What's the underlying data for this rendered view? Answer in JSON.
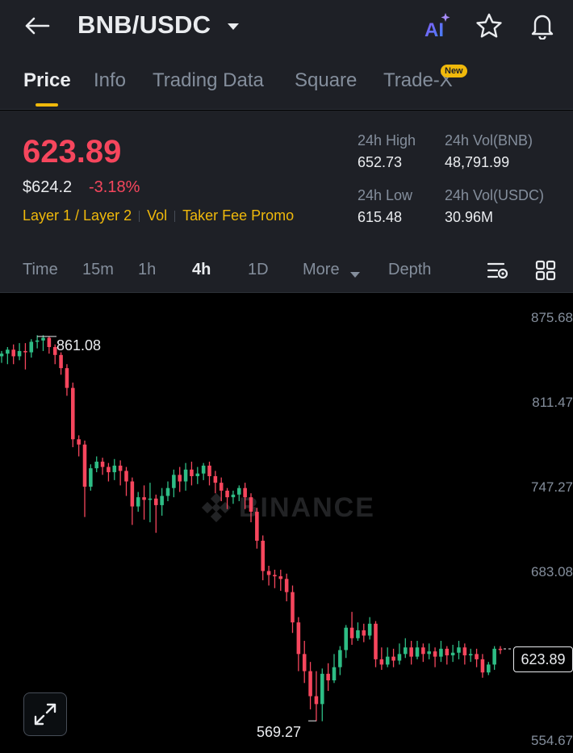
{
  "header": {
    "pair": "BNB/USDC",
    "icons": [
      "back-arrow-icon",
      "chevron-down-icon",
      "ai-icon",
      "star-icon",
      "bell-icon"
    ],
    "ai_label": "AI"
  },
  "tabs": [
    {
      "label": "Price",
      "active": true
    },
    {
      "label": "Info"
    },
    {
      "label": "Trading Data"
    },
    {
      "label": "Square"
    },
    {
      "label": "Trade-X",
      "badge": "New"
    }
  ],
  "ticker": {
    "last_price": "623.89",
    "usd_price": "$624.2",
    "change_pct": "-3.18%",
    "tags": [
      "Layer 1 / Layer 2",
      "Vol",
      "Taker Fee Promo"
    ],
    "high_label": "24h High",
    "high_value": "652.73",
    "low_label": "24h Low",
    "low_value": "615.48",
    "vol_base_label": "24h Vol(BNB)",
    "vol_base_value": "48,791.99",
    "vol_quote_label": "24h Vol(USDC)",
    "vol_quote_value": "30.96M"
  },
  "timeframes": [
    "Time",
    "15m",
    "1h",
    "4h",
    "1D",
    "More",
    "Depth"
  ],
  "active_timeframe": "4h",
  "chart": {
    "watermark": "BINANCE",
    "y_ticks": [
      "875.68",
      "811.47",
      "747.27",
      "683.08",
      "554.67"
    ],
    "high_label": "861.08",
    "low_label": "569.27",
    "last_price_label": "623.89",
    "colors": {
      "up": "#2ebd85",
      "down": "#f6465d",
      "accent": "#f0b90b"
    }
  },
  "chart_data": {
    "type": "candlestick",
    "ylim": [
      554.67,
      875.68
    ],
    "y_ticks": [
      875.68,
      811.47,
      747.27,
      683.08,
      554.67
    ],
    "marked_high": 861.08,
    "marked_low": 569.27,
    "last": 623.89,
    "candles": [
      [
        846,
        848,
        841,
        850
      ],
      [
        848,
        851,
        840,
        853
      ],
      [
        851,
        846,
        840,
        855
      ],
      [
        846,
        850,
        843,
        856
      ],
      [
        850,
        849,
        836,
        856
      ],
      [
        849,
        857,
        845,
        859
      ],
      [
        857,
        858,
        852,
        862
      ],
      [
        858,
        860,
        850,
        862
      ],
      [
        860,
        853,
        848,
        861
      ],
      [
        853,
        847,
        840,
        855
      ],
      [
        847,
        837,
        832,
        849
      ],
      [
        837,
        822,
        816,
        840
      ],
      [
        822,
        783,
        777,
        826
      ],
      [
        783,
        779,
        770,
        786
      ],
      [
        779,
        747,
        724,
        782
      ],
      [
        747,
        761,
        744,
        764
      ],
      [
        761,
        766,
        758,
        770
      ],
      [
        766,
        762,
        756,
        769
      ],
      [
        762,
        758,
        751,
        765
      ],
      [
        758,
        763,
        752,
        768
      ],
      [
        763,
        759,
        748,
        767
      ],
      [
        759,
        751,
        740,
        762
      ],
      [
        751,
        732,
        718,
        754
      ],
      [
        732,
        739,
        728,
        743
      ],
      [
        739,
        737,
        722,
        748
      ],
      [
        737,
        738,
        720,
        750
      ],
      [
        738,
        733,
        712,
        741
      ],
      [
        733,
        740,
        725,
        746
      ],
      [
        740,
        746,
        736,
        751
      ],
      [
        746,
        756,
        739,
        760
      ],
      [
        756,
        751,
        743,
        762
      ],
      [
        751,
        760,
        744,
        765
      ],
      [
        760,
        755,
        748,
        766
      ],
      [
        755,
        757,
        749,
        762
      ],
      [
        757,
        763,
        752,
        765
      ],
      [
        763,
        755,
        748,
        766
      ],
      [
        755,
        750,
        742,
        759
      ],
      [
        750,
        744,
        736,
        754
      ],
      [
        744,
        739,
        730,
        746
      ],
      [
        739,
        741,
        734,
        744
      ],
      [
        741,
        746,
        736,
        748
      ],
      [
        746,
        739,
        730,
        750
      ],
      [
        739,
        728,
        720,
        742
      ],
      [
        728,
        706,
        700,
        731
      ],
      [
        706,
        683,
        676,
        710
      ],
      [
        683,
        680,
        672,
        687
      ],
      [
        680,
        679,
        670,
        684
      ],
      [
        679,
        677,
        668,
        684
      ],
      [
        677,
        667,
        660,
        681
      ],
      [
        667,
        644,
        636,
        672
      ],
      [
        644,
        620,
        607,
        648
      ],
      [
        620,
        607,
        598,
        630
      ],
      [
        607,
        588,
        578,
        614
      ],
      [
        588,
        582,
        569,
        607
      ],
      [
        582,
        605,
        569,
        609
      ],
      [
        605,
        600,
        592,
        613
      ],
      [
        600,
        610,
        598,
        620
      ],
      [
        610,
        623,
        604,
        626
      ],
      [
        623,
        640,
        617,
        642
      ],
      [
        640,
        632,
        627,
        652
      ],
      [
        632,
        638,
        630,
        644
      ],
      [
        638,
        634,
        629,
        643
      ],
      [
        634,
        643,
        631,
        648
      ],
      [
        643,
        616,
        610,
        645
      ],
      [
        616,
        612,
        608,
        625
      ],
      [
        612,
        618,
        610,
        625
      ],
      [
        618,
        615,
        610,
        624
      ],
      [
        615,
        620,
        612,
        628
      ],
      [
        620,
        625,
        617,
        632
      ],
      [
        625,
        618,
        612,
        630
      ],
      [
        618,
        625,
        616,
        630
      ],
      [
        625,
        620,
        614,
        628
      ],
      [
        620,
        622,
        616,
        628
      ],
      [
        622,
        618,
        610,
        625
      ],
      [
        618,
        624,
        614,
        630
      ],
      [
        624,
        619,
        612,
        626
      ],
      [
        619,
        621,
        614,
        627
      ],
      [
        621,
        625,
        616,
        630
      ],
      [
        625,
        619,
        612,
        628
      ],
      [
        619,
        620,
        614,
        624
      ],
      [
        620,
        616,
        610,
        624
      ],
      [
        616,
        606,
        602,
        620
      ],
      [
        606,
        612,
        604,
        614
      ],
      [
        612,
        624,
        608,
        626
      ],
      [
        624,
        623,
        620,
        626
      ]
    ]
  }
}
